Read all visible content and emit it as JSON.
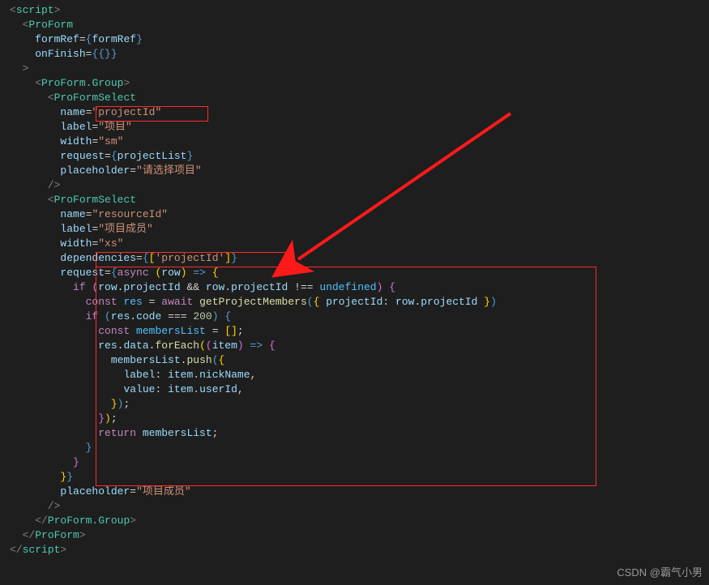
{
  "watermark": "CSDN @霸气小男",
  "code": {
    "lines": [
      "<script>",
      "  <ProForm",
      "    formRef={formRef}",
      "    onFinish={{}}",
      "  >",
      "    <ProForm.Group>",
      "      <ProFormSelect",
      "        name=\"projectId\"",
      "        label=\"项目\"",
      "        width=\"sm\"",
      "        request={projectList}",
      "        placeholder=\"请选择项目\"",
      "      />",
      "      <ProFormSelect",
      "        name=\"resourceId\"",
      "        label=\"项目成员\"",
      "        width=\"xs\"",
      "        dependencies={['projectId']}",
      "        request={async (row) => {",
      "          if (row.projectId && row.projectId !== undefined) {",
      "            const res = await getProjectMembers({ projectId: row.projectId })",
      "            if (res.code === 200) {",
      "              const membersList = [];",
      "              res.data.forEach((item) => {",
      "                membersList.push({",
      "                  label: item.nickName,",
      "                  value: item.userId,",
      "                });",
      "              });",
      "              return membersList;",
      "            }",
      "          }",
      "        }}",
      "        placeholder=\"项目成员\"",
      "      />",
      "    </ProForm.Group>",
      "  </ProForm>",
      "</script>"
    ]
  },
  "highlighted_boxes": [
    "name=\"projectId\"",
    "dependencies={['projectId']}",
    "request async block"
  ]
}
